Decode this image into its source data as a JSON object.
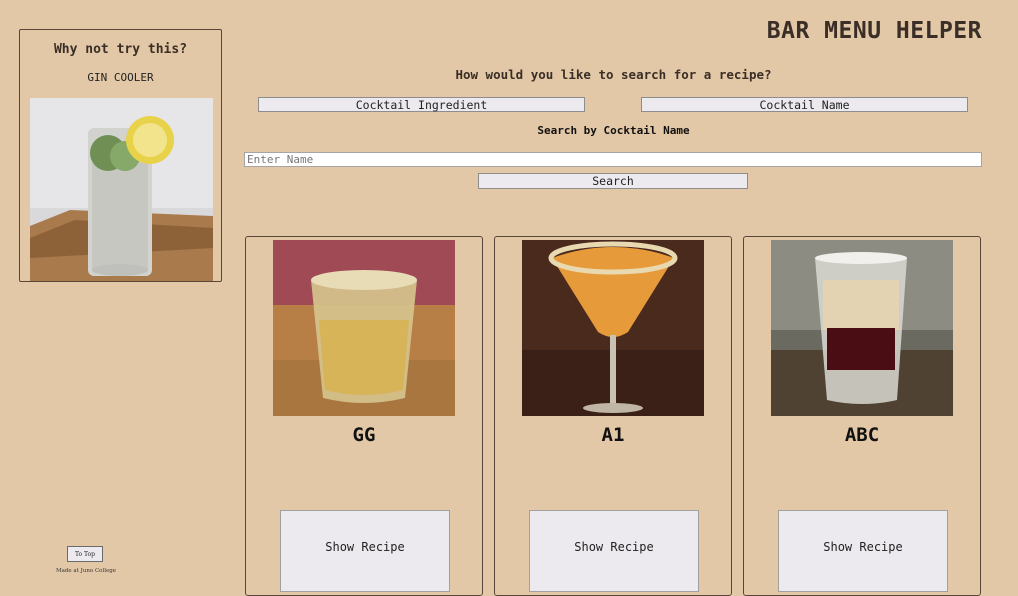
{
  "sidebar": {
    "heading": "Why not try this?",
    "featured_name": "GIN COOLER",
    "to_top_label": "To Top",
    "footer_text": "Made at Juno College"
  },
  "header": {
    "title": "BAR MENU HELPER"
  },
  "search": {
    "question": "How would you like to search for a recipe?",
    "mode_ingredient_label": "Cocktail Ingredient",
    "mode_name_label": "Cocktail Name",
    "active_mode_label": "Search by Cocktail Name",
    "input_placeholder": "Enter Name",
    "input_value": "",
    "button_label": "Search"
  },
  "results": [
    {
      "name": "GG",
      "button_label": "Show Recipe"
    },
    {
      "name": "A1",
      "button_label": "Show Recipe"
    },
    {
      "name": "ABC",
      "button_label": "Show Recipe"
    }
  ],
  "colors": {
    "background": "#e2c8a6",
    "border": "#5a4638",
    "button": "#eceaef",
    "title_text": "#3a2e26"
  }
}
